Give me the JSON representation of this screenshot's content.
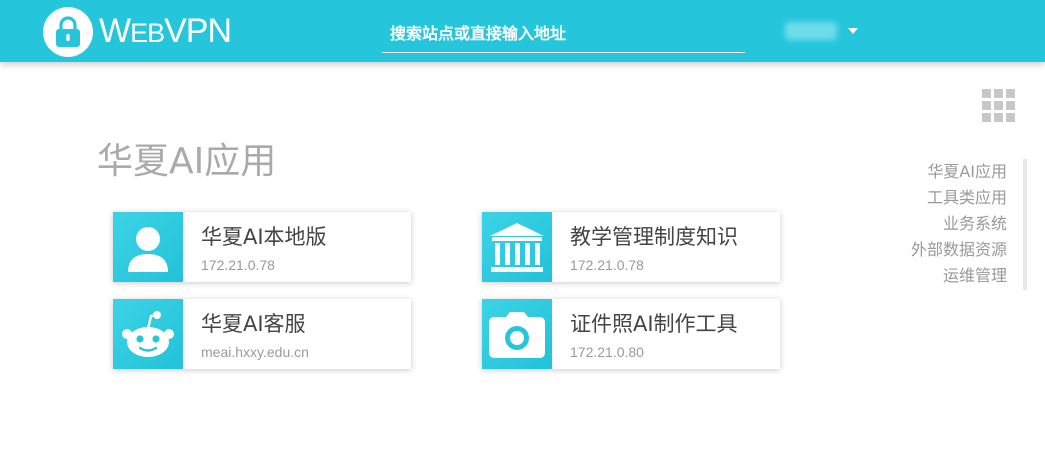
{
  "header": {
    "logo_text_prefix": "W",
    "logo_text_mid": "EB",
    "logo_text_suffix": "VPN",
    "logo_icon": "lock-icon",
    "search_placeholder": "搜索站点或直接输入地址",
    "user_menu_icon": "caret-down-icon"
  },
  "colors": {
    "brand": "#25c6dc",
    "title_gray": "#aaaaaa",
    "text_dark": "#444444",
    "text_light": "#9a9a9a"
  },
  "apps_menu_icon": "grid-icon",
  "section": {
    "title": "华夏AI应用"
  },
  "cards": [
    {
      "name": "华夏AI本地版",
      "address": "172.21.0.78",
      "icon": "user-icon"
    },
    {
      "name": "教学管理制度知识",
      "address": "172.21.0.78",
      "icon": "bank-building-icon"
    },
    {
      "name": "华夏AI客服",
      "address": "meai.hxxy.edu.cn",
      "icon": "robot-icon"
    },
    {
      "name": "证件照AI制作工具",
      "address": "172.21.0.80",
      "icon": "camera-icon"
    }
  ],
  "side_nav": {
    "items": [
      {
        "label": "华夏AI应用"
      },
      {
        "label": "工具类应用"
      },
      {
        "label": "业务系统"
      },
      {
        "label": "外部数据资源"
      },
      {
        "label": "运维管理"
      }
    ]
  }
}
